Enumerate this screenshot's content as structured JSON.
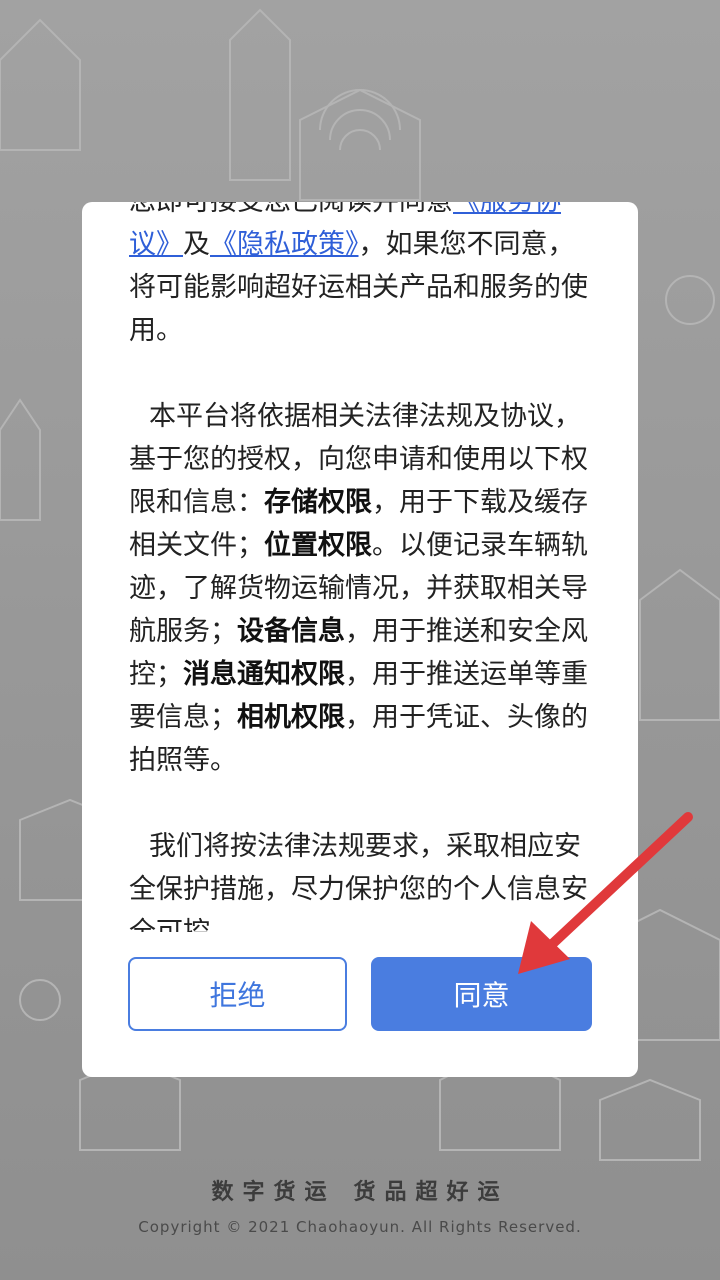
{
  "background": {
    "slogan_left": "数字货运",
    "slogan_right": "货品超好运",
    "copyright": "Copyright © 2021 Chaohaoyun. All Rights Reserved."
  },
  "dialog": {
    "p1_prefix": "您即可接受您已阅读并同意",
    "service_agreement_link": "《服务协议》",
    "p1_and": "及",
    "privacy_policy_link": "《隐私政策》",
    "p1_suffix": "，如果您不同意，将可能影响超好运相关产品和服务的使用。",
    "p2_intro": "本平台将依据相关法律法规及协议，基于您的授权，向您申请和使用以下权限和信息：",
    "perm_storage": "存储权限",
    "perm_storage_desc": "，用于下载及缓存相关文件；",
    "perm_location": "位置权限",
    "perm_location_desc": "。以便记录车辆轨迹，了解货物运输情况，并获取相关导航服务；",
    "perm_device": "设备信息",
    "perm_device_desc": "，用于推送和安全风控；",
    "perm_notify": "消息通知权限",
    "perm_notify_desc": "，用于推送运单等重要信息；",
    "perm_camera": "相机权限",
    "perm_camera_desc": "，用于凭证、头像的拍照等。",
    "p3": "我们将按法律法规要求，采取相应安全保护措施，尽力保护您的个人信息安全可控。",
    "reject_button": "拒绝",
    "agree_button": "同意"
  },
  "colors": {
    "accent": "#4a7de0",
    "link": "#2f5fd8",
    "annotation_arrow": "#e0393b"
  }
}
